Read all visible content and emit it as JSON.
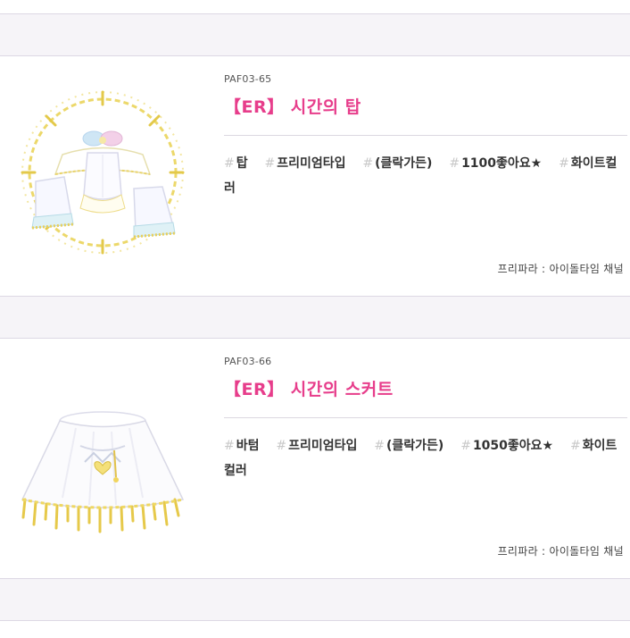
{
  "products": [
    {
      "code": "PAF03-65",
      "title": "【ER】 시간의 탑",
      "tags": [
        {
          "hash": "#",
          "text": "탑"
        },
        {
          "hash": "#",
          "text": "프리미엄타입"
        },
        {
          "hash": "#",
          "text": "(클락가든)"
        },
        {
          "hash": "#",
          "text": "1100좋아요★"
        },
        {
          "hash": "#",
          "text": "화이트컬러"
        }
      ],
      "channel": "프리파라 : 아이돌타임 채널",
      "image_icon": "white-top-dress-with-golden-clock-ring-icon"
    },
    {
      "code": "PAF03-66",
      "title": "【ER】 시간의 스커트",
      "tags": [
        {
          "hash": "#",
          "text": "바텀"
        },
        {
          "hash": "#",
          "text": "프리미엄타입"
        },
        {
          "hash": "#",
          "text": "(클락가든)"
        },
        {
          "hash": "#",
          "text": "1050좋아요★"
        },
        {
          "hash": "#",
          "text": "화이트컬러"
        }
      ],
      "channel": "프리파라 : 아이돌타임 채널",
      "image_icon": "white-skirt-with-golden-clock-fringe-icon"
    }
  ],
  "colors": {
    "title_pink": "#e73d8b",
    "hash_gray": "#c8c8c8",
    "background": "#f6f4f8",
    "gold": "#e8d25a"
  }
}
